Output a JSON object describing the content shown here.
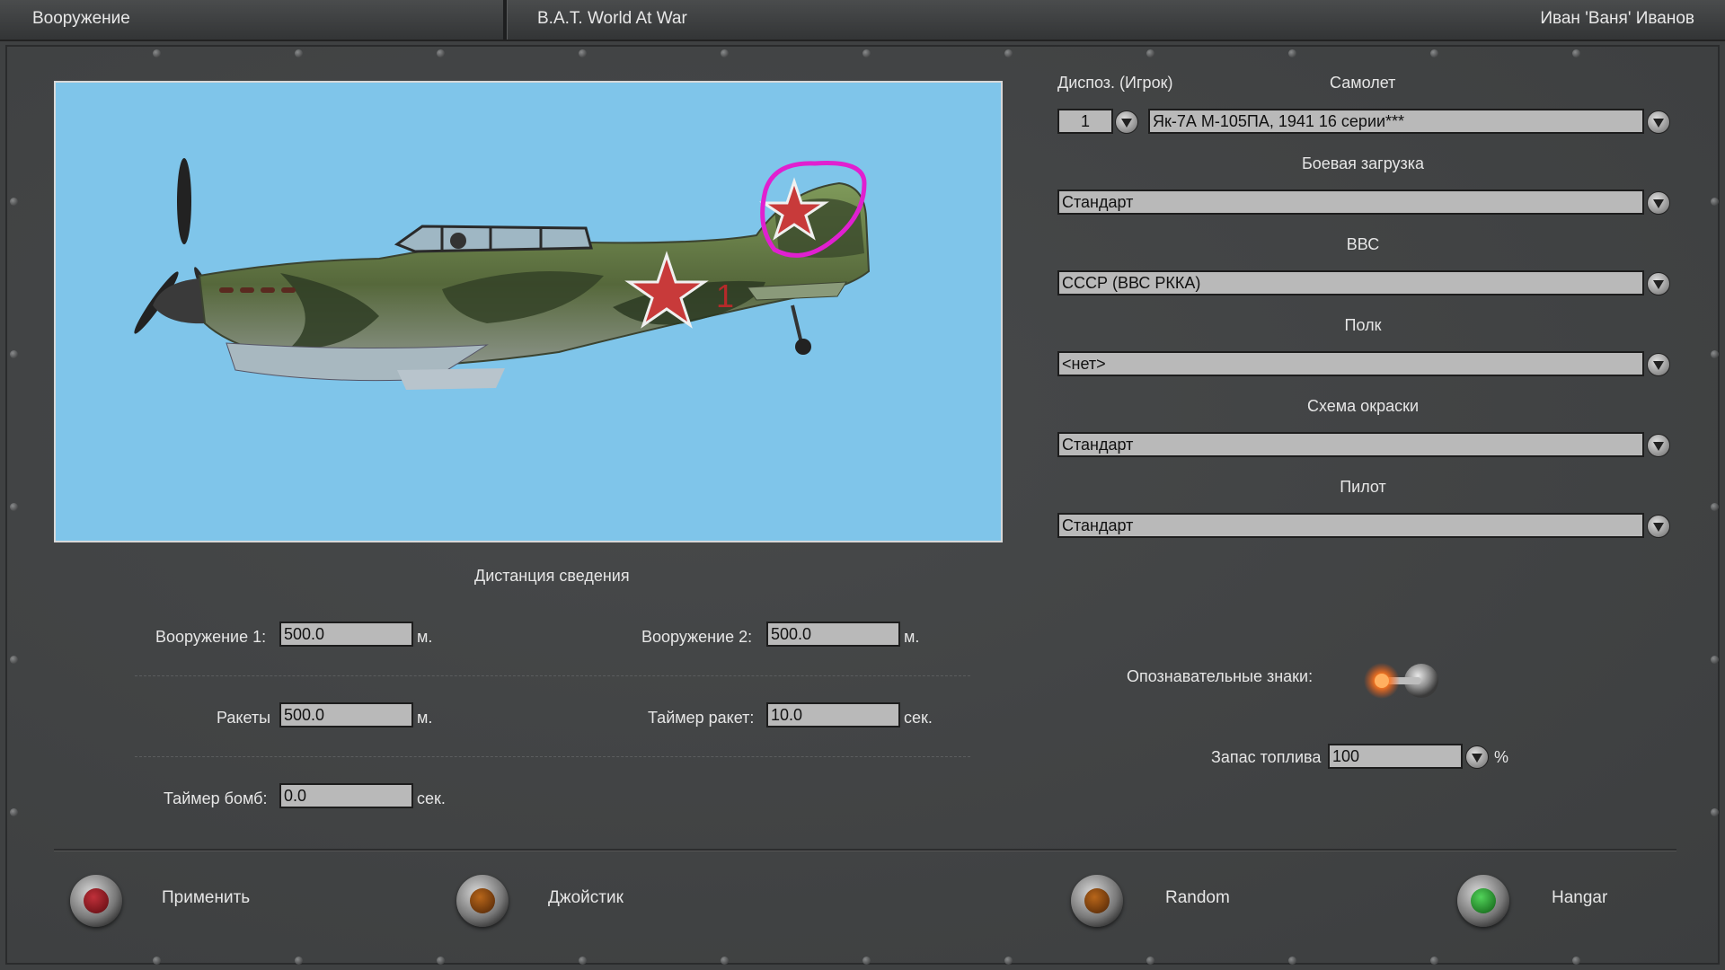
{
  "topbar": {
    "section": "Вооружение",
    "game": "B.A.T. World At War",
    "player": "Иван 'Ваня' Иванов"
  },
  "aircraft_panel": {
    "dispo_label": "Диспоз. (Игрок)",
    "dispo_value": "1",
    "plane_label": "Самолет",
    "plane_value": "Як-7А М-105ПА, 1941 16 серии***",
    "loadout_label": "Боевая загрузка",
    "loadout_value": "Стандарт",
    "airforce_label": "ВВС",
    "airforce_value": "СССР (ВВС РККА)",
    "regiment_label": "Полк",
    "regiment_value": "<нет>",
    "paint_label": "Схема окраски",
    "paint_value": "Стандарт",
    "pilot_label": "Пилот",
    "pilot_value": "Стандарт"
  },
  "convergence": {
    "title": "Дистанция сведения",
    "weapon1_label": "Вооружение 1:",
    "weapon1_value": "500.0",
    "weapon1_unit": "м.",
    "weapon2_label": "Вооружение 2:",
    "weapon2_value": "500.0",
    "weapon2_unit": "м.",
    "rockets_label": "Ракеты",
    "rockets_value": "500.0",
    "rockets_unit": "м.",
    "rocket_timer_label": "Таймер ракет:",
    "rocket_timer_value": "10.0",
    "rocket_timer_unit": "сек.",
    "bomb_timer_label": "Таймер бомб:",
    "bomb_timer_value": "0.0",
    "bomb_timer_unit": "сек."
  },
  "markings": {
    "label": "Опознавательные знаки:",
    "enabled": true
  },
  "fuel": {
    "label": "Запас топлива",
    "value": "100",
    "unit": "%"
  },
  "buttons": {
    "apply": "Применить",
    "joystick": "Джойстик",
    "random": "Random",
    "hangar": "Hangar"
  },
  "colors": {
    "preview_sky": "#7fc5ea",
    "annotation_circle": "#e020d0",
    "lamp_red": "#7a0f12",
    "lamp_amber": "#7a3a08",
    "lamp_green": "#1f8a25"
  }
}
